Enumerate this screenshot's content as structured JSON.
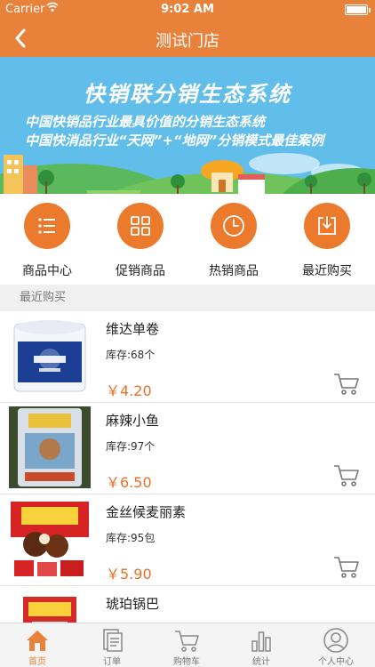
{
  "status_bar": {
    "carrier": "Carrier",
    "time": "9:02 AM"
  },
  "nav": {
    "title": "测试门店",
    "back_icon": "chevron-left-icon"
  },
  "banner": {
    "title": "快销联分销生态系统",
    "subtitle_1": "中国快销品行业最具价值的分销生态系统",
    "subtitle_2": "中国快消品行业“天网”+“地网”分销模式最佳案例"
  },
  "categories": [
    {
      "label": "商品中心",
      "icon": "list-icon"
    },
    {
      "label": "促销商品",
      "icon": "grid-icon"
    },
    {
      "label": "热销商品",
      "icon": "clock-icon"
    },
    {
      "label": "最近购买",
      "icon": "download-icon"
    }
  ],
  "section": {
    "title": "最近购买"
  },
  "products": [
    {
      "name": "维达单卷",
      "stock": "库存:68个",
      "price": "￥4.20"
    },
    {
      "name": "麻辣小鱼",
      "stock": "库存:97个",
      "price": "￥6.50"
    },
    {
      "name": "金丝候麦丽素",
      "stock": "库存:95包",
      "price": "￥5.90"
    },
    {
      "name": "琥珀锅巴",
      "stock": "",
      "price": ""
    }
  ],
  "tabs": [
    {
      "label": "首页",
      "icon": "home-icon",
      "active": true
    },
    {
      "label": "订单",
      "icon": "orders-icon",
      "active": false
    },
    {
      "label": "购物车",
      "icon": "cart-icon",
      "active": false
    },
    {
      "label": "统计",
      "icon": "stats-icon",
      "active": false
    },
    {
      "label": "个人中心",
      "icon": "user-icon",
      "active": false
    }
  ],
  "colors": {
    "accent": "#e8813a",
    "banner": "#61bde9",
    "price": "#e8702a"
  }
}
